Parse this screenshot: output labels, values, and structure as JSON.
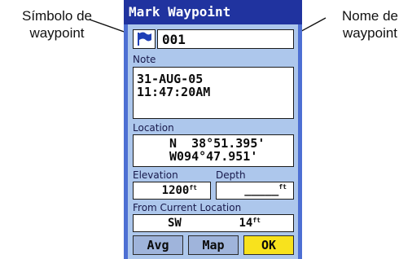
{
  "callouts": {
    "left_line1": "Símbolo de",
    "left_line2": "waypoint",
    "right_line1": "Nome de",
    "right_line2": "waypoint"
  },
  "window": {
    "title": "Mark Waypoint"
  },
  "waypoint": {
    "symbol_icon": "flag-icon",
    "name": "001"
  },
  "note": {
    "label": "Note",
    "line1": "31-AUG-05",
    "line2": "11:47:20AM"
  },
  "location": {
    "label": "Location",
    "lat": "N  38°51.395'",
    "lon": "W094°47.951'"
  },
  "elevation": {
    "label": "Elevation",
    "value": "1200",
    "unit": "ft"
  },
  "depth": {
    "label": "Depth",
    "value": "_____",
    "unit": "ft"
  },
  "from_current": {
    "label": "From Current Location",
    "direction": "SW",
    "distance": "14",
    "unit": "ft"
  },
  "buttons": {
    "avg": "Avg",
    "map": "Map",
    "ok": "OK"
  },
  "colors": {
    "title_bar": "#20339f",
    "panel": "#adc7ec",
    "ok_button": "#f8e21d",
    "flag": "#1f3fb6"
  }
}
